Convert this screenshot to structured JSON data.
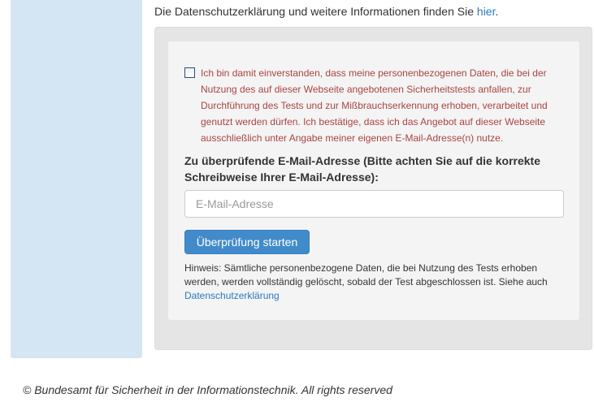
{
  "intro": {
    "text": "Die Datenschutzerklärung und weitere Informationen finden Sie ",
    "link": "hier",
    "after": "."
  },
  "form": {
    "consent": "Ich bin damit einverstanden, dass meine personenbezogenen Daten, die bei der Nutzung des auf dieser Webseite angebotenen Sicherheitstests anfallen, zur Durchführung des Tests und zur Mißbrauchserkennung erhoben, verarbeitet und genutzt werden dürfen. Ich bestätige, dass ich das Angebot auf dieser Webseite ausschließlich unter Angabe meiner eigenen E-Mail-Adresse(n) nutze.",
    "email_label": "Zu überprüfende E-Mail-Adresse (Bitte achten Sie auf die korrekte Schreibweise Ihrer E-Mail-Adresse):",
    "email_placeholder": "E-Mail-Adresse",
    "email_value": "",
    "submit": "Überprüfung starten",
    "hint": "Hinweis: Sämtliche personenbezogene Daten, die bei Nutzung des Tests erhoben werden, werden vollständig gelöscht, sobald der Test abgeschlossen ist. Siehe auch ",
    "hint_link": "Datenschutzerklärung"
  },
  "footer": "© Bundesamt für Sicherheit in der Informationstechnik. All rights reserved"
}
